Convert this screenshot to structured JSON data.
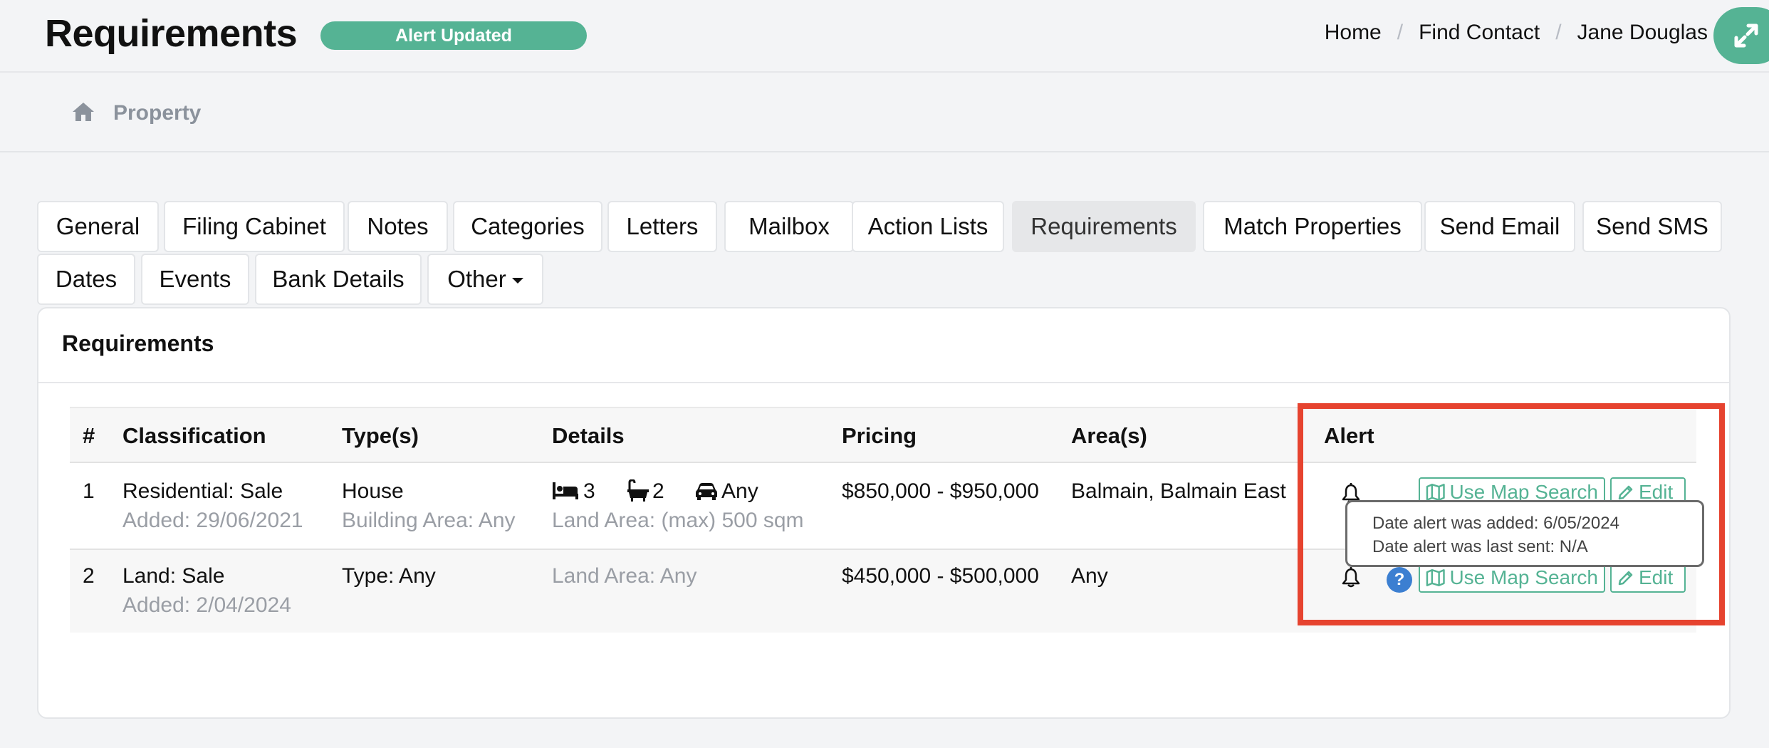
{
  "header": {
    "title": "Requirements",
    "status_badge": "Alert Updated",
    "breadcrumb": [
      "Home",
      "Find Contact",
      "Jane Douglas"
    ],
    "separator": "/"
  },
  "subheader": {
    "label": "Property"
  },
  "tabs": {
    "row1": [
      "General",
      "Filing Cabinet",
      "Notes",
      "Categories",
      "Letters",
      "Mailbox",
      "Action Lists",
      "Requirements",
      "Match Properties",
      "Send Email",
      "Send SMS"
    ],
    "row2": [
      "Dates",
      "Events",
      "Bank Details",
      "Other"
    ],
    "active": "Requirements"
  },
  "panel": {
    "title": "Requirements",
    "columns": [
      "#",
      "Classification",
      "Type(s)",
      "Details",
      "Pricing",
      "Area(s)",
      "Alert"
    ],
    "rows": [
      {
        "num": "1",
        "classification": "Residential: Sale",
        "added": "Added: 29/06/2021",
        "type": "House",
        "type_sub": "Building Area: Any",
        "beds": "3",
        "baths": "2",
        "cars": "Any",
        "land": "Land Area: (max) 500 sqm",
        "pricing": "$850,000 - $950,000",
        "areas": "Balmain, Balmain East"
      },
      {
        "num": "2",
        "classification": "Land: Sale",
        "added": "Added: 2/04/2024",
        "type": "Type: Any",
        "land": "Land Area: Any",
        "pricing": "$450,000 - $500,000",
        "areas": "Any"
      }
    ],
    "map_button": "Use Map Search",
    "edit_button": "Edit",
    "help_badge": "?",
    "tooltip": {
      "line1": "Date alert was added: 6/05/2024",
      "line2": "Date alert was last sent: N/A"
    }
  },
  "colors": {
    "accent": "#55b394",
    "highlight": "#e6432f",
    "help": "#3c7fd1"
  },
  "icons": [
    "expand-icon",
    "home-icon",
    "bed-icon",
    "bath-icon",
    "car-icon",
    "bell-icon",
    "map-icon",
    "pencil-icon",
    "caret-down-icon"
  ]
}
